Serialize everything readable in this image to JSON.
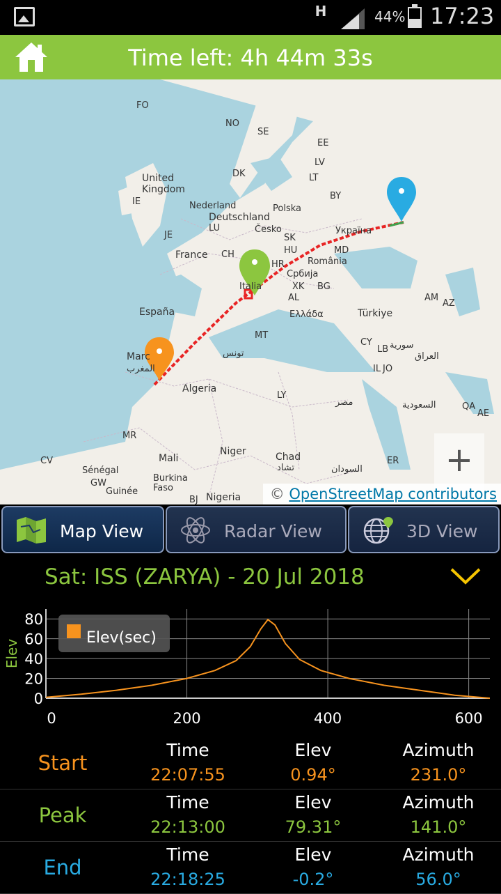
{
  "status_bar": {
    "network": "H",
    "battery": "44%",
    "time": "17:23"
  },
  "header": {
    "title": "Time left: 4h 44m 33s"
  },
  "map": {
    "labels": [
      "FO",
      "NO",
      "SE",
      "United Kingdom",
      "DK",
      "EE",
      "LV",
      "LT",
      "IE",
      "Nederland",
      "Polska",
      "BY",
      "Deutschland",
      "LU",
      "Česko",
      "SK",
      "Україна",
      "JE",
      "France",
      "CH",
      "HU",
      "MD",
      "România",
      "Italia",
      "HR",
      "Србија",
      "XK",
      "BG",
      "AL",
      "Ελλάδα",
      "España",
      "Türkiye",
      "AM",
      "AZ",
      "MT",
      "CY",
      "LB",
      "سورية",
      "IL",
      "JO",
      "العراق",
      "Marc",
      "المغرب",
      "تونس",
      "Algeria",
      "LY",
      "مصر",
      "السعودية",
      "QA",
      "AE",
      "MR",
      "CV",
      "Mali",
      "Niger",
      "Chad",
      "تشاد",
      "السودان",
      "ER",
      "Sénégal",
      "GW",
      "Burkina Faso",
      "Guinée",
      "BJ",
      "Nigeria"
    ],
    "attribution_symbol": "©",
    "attribution_link": "OpenStreetMap contributors"
  },
  "zoom": {
    "in": "+",
    "out": "−"
  },
  "tabs": [
    {
      "label": "Map View",
      "icon": "map-icon",
      "active": true
    },
    {
      "label": "Radar View",
      "icon": "radar-icon",
      "active": false
    },
    {
      "label": "3D View",
      "icon": "globe-icon",
      "active": false
    }
  ],
  "satellite_header": "Sat: ISS (ZARYA) - 20 Jul 2018",
  "chart_data": {
    "type": "line",
    "ylabel": "Elev",
    "xlabel": "",
    "legend": "Elev(sec)",
    "legend_position": "top-left",
    "xlim": [
      0,
      630
    ],
    "ylim": [
      0,
      90
    ],
    "x_ticks": [
      "0",
      "200",
      "400",
      "600"
    ],
    "y_ticks": [
      "0",
      "20",
      "40",
      "60",
      "80"
    ],
    "grid": true,
    "series": [
      {
        "name": "Elev(sec)",
        "color": "#f7931e",
        "x": [
          0,
          50,
          100,
          150,
          200,
          240,
          270,
          290,
          305,
          315,
          325,
          340,
          360,
          390,
          430,
          480,
          530,
          580,
          630
        ],
        "y": [
          0.9,
          4,
          8,
          13,
          20,
          28,
          38,
          52,
          70,
          79.3,
          74,
          55,
          39,
          28,
          20,
          13,
          8,
          3,
          -0.2
        ]
      }
    ]
  },
  "passes": [
    {
      "name": "Start",
      "color": "#f7931e",
      "time_label": "Time",
      "elev_label": "Elev",
      "azimuth_label": "Azimuth",
      "time": "22:07:55",
      "elev": "0.94°",
      "azimuth": "231.0°"
    },
    {
      "name": "Peak",
      "color": "#8cc63f",
      "time_label": "Time",
      "elev_label": "Elev",
      "azimuth_label": "Azimuth",
      "time": "22:13:00",
      "elev": "79.31°",
      "azimuth": "141.0°"
    },
    {
      "name": "End",
      "color": "#29abe2",
      "time_label": "Time",
      "elev_label": "Elev",
      "azimuth_label": "Azimuth",
      "time": "22:18:25",
      "elev": "-0.2°",
      "azimuth": "56.0°"
    }
  ],
  "colors": {
    "accent": "#8cc63f",
    "start": "#f7931e",
    "end": "#29abe2",
    "track": "#e82424"
  }
}
